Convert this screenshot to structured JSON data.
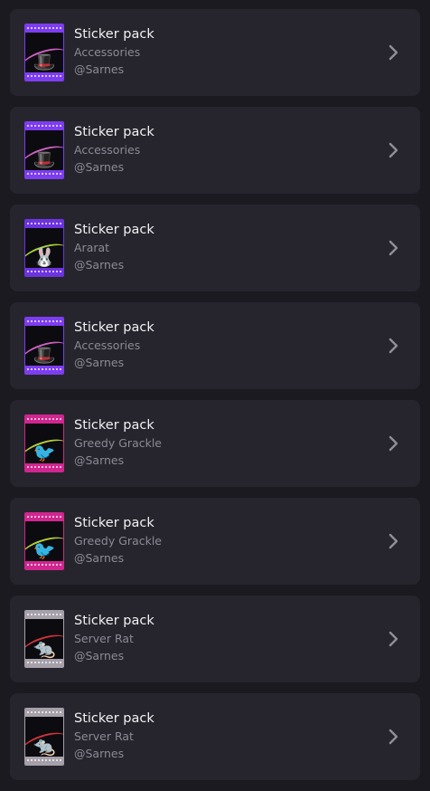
{
  "packs": [
    {
      "title": "Sticker pack",
      "subtitle": "Accessories",
      "author": "@Sarnes",
      "thumbnail": {
        "icon": "top-hat-sticker",
        "glyph": "🎩",
        "band": "#7d3df0",
        "accent": "#e36bd8"
      }
    },
    {
      "title": "Sticker pack",
      "subtitle": "Accessories",
      "author": "@Sarnes",
      "thumbnail": {
        "icon": "top-hat-sticker",
        "glyph": "🎩",
        "band": "#7d3df0",
        "accent": "#e36bd8"
      }
    },
    {
      "title": "Sticker pack",
      "subtitle": "Ararat",
      "author": "@Sarnes",
      "thumbnail": {
        "icon": "ararat-sticker",
        "glyph": "🐰",
        "band": "#6d33e0",
        "accent": "#b7ea3a"
      }
    },
    {
      "title": "Sticker pack",
      "subtitle": "Accessories",
      "author": "@Sarnes",
      "thumbnail": {
        "icon": "top-hat-sticker",
        "glyph": "🎩",
        "band": "#7d3df0",
        "accent": "#e36bd8"
      }
    },
    {
      "title": "Sticker pack",
      "subtitle": "Greedy Grackle",
      "author": "@Sarnes",
      "thumbnail": {
        "icon": "grackle-sticker",
        "glyph": "🐦",
        "band": "#d1268f",
        "accent": "#c9e23a"
      }
    },
    {
      "title": "Sticker pack",
      "subtitle": "Greedy Grackle",
      "author": "@Sarnes",
      "thumbnail": {
        "icon": "grackle-sticker",
        "glyph": "🐦",
        "band": "#d1268f",
        "accent": "#c9e23a"
      }
    },
    {
      "title": "Sticker pack",
      "subtitle": "Server Rat",
      "author": "@Sarnes",
      "thumbnail": {
        "icon": "server-rat-sticker",
        "glyph": "🐀",
        "band": "#a6a0aa",
        "accent": "#e2383d"
      }
    },
    {
      "title": "Sticker pack",
      "subtitle": "Server Rat",
      "author": "@Sarnes",
      "thumbnail": {
        "icon": "server-rat-sticker",
        "glyph": "🐀",
        "band": "#a6a0aa",
        "accent": "#e2383d"
      }
    }
  ],
  "chevron_icon": "chevron-right-icon"
}
